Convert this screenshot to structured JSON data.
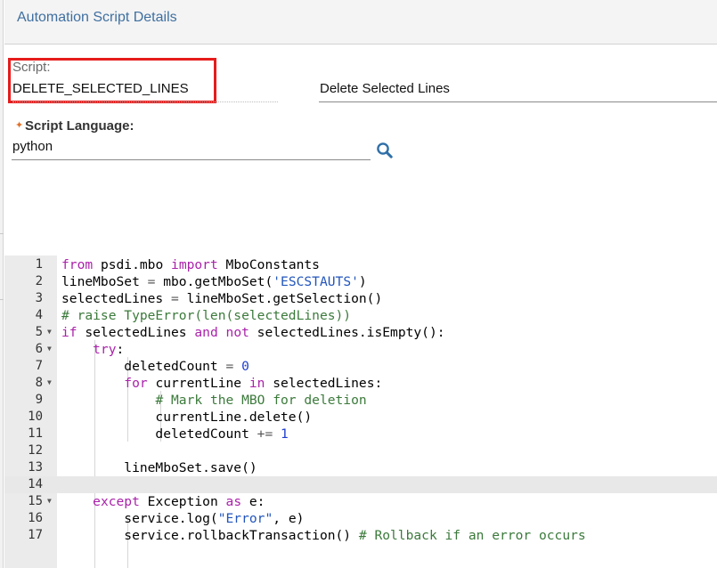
{
  "header": {
    "title": "Automation Script Details"
  },
  "script_field": {
    "label": "Script:",
    "value": "DELETE_SELECTED_LINES"
  },
  "description_field": {
    "value": "Delete Selected Lines"
  },
  "language_field": {
    "required_marker": "✦",
    "label": "Script Language:",
    "value": "python",
    "lookup_icon": "search-icon"
  },
  "editor": {
    "active_line": 14,
    "lines": [
      {
        "n": "1",
        "fold": false,
        "t": "from psdi.mbo import MboConstants"
      },
      {
        "n": "2",
        "fold": false,
        "t": "lineMboSet = mbo.getMboSet('ESCSTAUTS')"
      },
      {
        "n": "3",
        "fold": false,
        "t": "selectedLines = lineMboSet.getSelection()"
      },
      {
        "n": "4",
        "fold": false,
        "t": "# raise TypeError(len(selectedLines))"
      },
      {
        "n": "5",
        "fold": true,
        "t": "if selectedLines and not selectedLines.isEmpty():"
      },
      {
        "n": "6",
        "fold": true,
        "t": "    try:"
      },
      {
        "n": "7",
        "fold": false,
        "t": "        deletedCount = 0"
      },
      {
        "n": "8",
        "fold": true,
        "t": "        for currentLine in selectedLines:"
      },
      {
        "n": "9",
        "fold": false,
        "t": "            # Mark the MBO for deletion"
      },
      {
        "n": "10",
        "fold": false,
        "t": "            currentLine.delete()"
      },
      {
        "n": "11",
        "fold": false,
        "t": "            deletedCount += 1"
      },
      {
        "n": "12",
        "fold": false,
        "t": ""
      },
      {
        "n": "13",
        "fold": false,
        "t": "        lineMboSet.save()"
      },
      {
        "n": "14",
        "fold": false,
        "t": ""
      },
      {
        "n": "15",
        "fold": true,
        "t": "    except Exception as e:"
      },
      {
        "n": "16",
        "fold": false,
        "t": "        service.log(\"Error\", e)"
      },
      {
        "n": "17",
        "fold": false,
        "t": "        service.rollbackTransaction() # Rollback if an error occurs"
      }
    ]
  }
}
